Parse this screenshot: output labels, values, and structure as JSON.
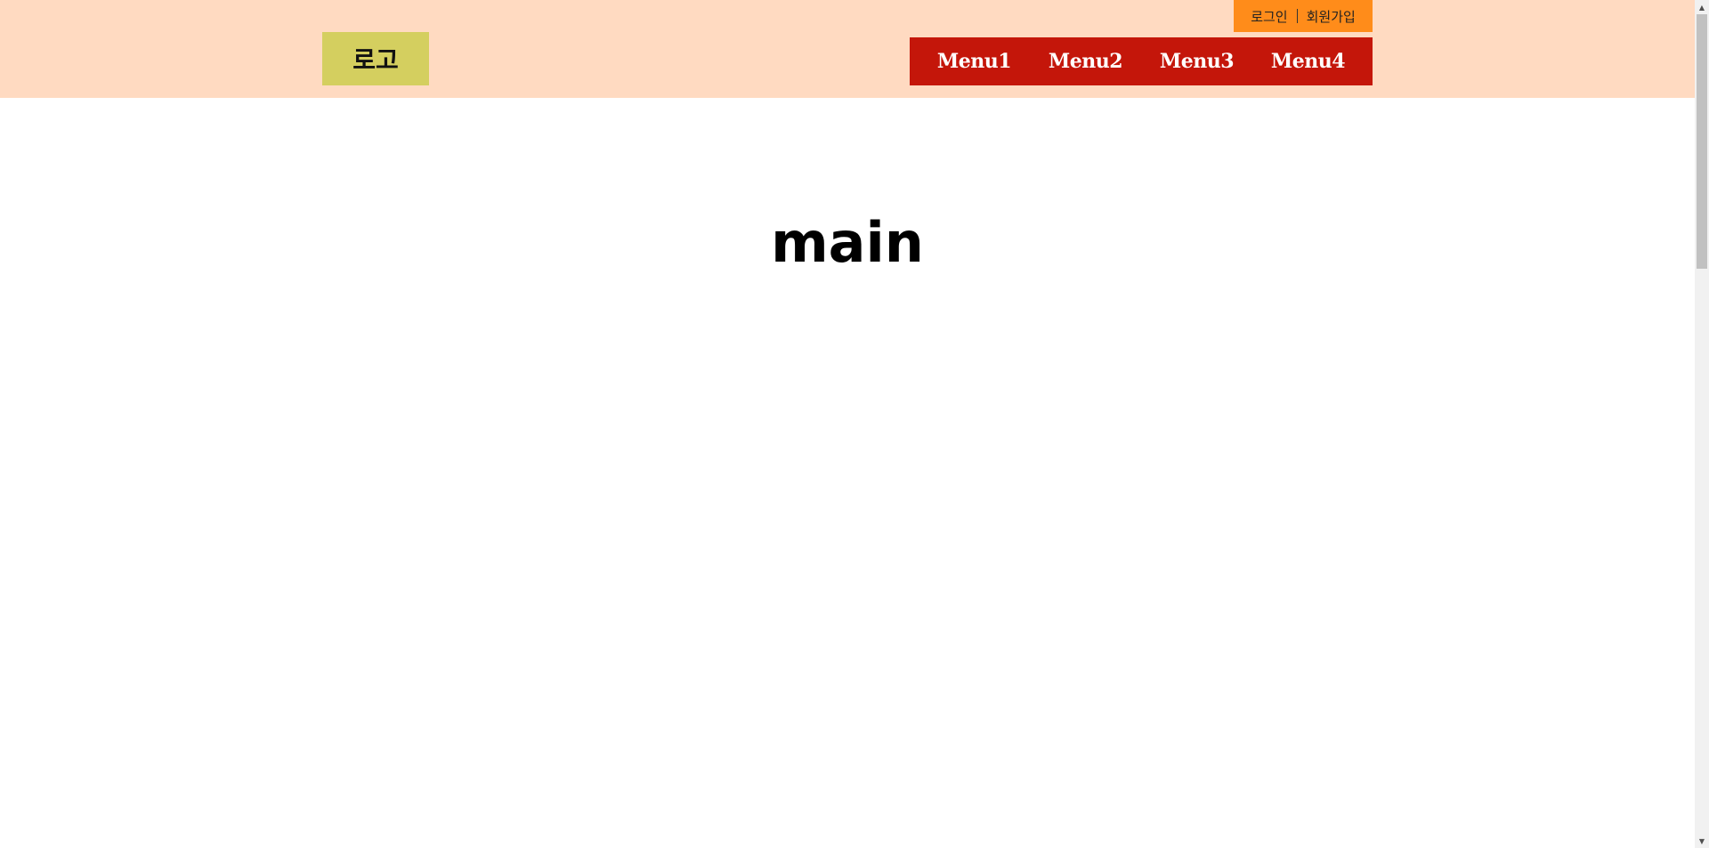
{
  "header": {
    "util_links": [
      "로그인",
      "회원가입"
    ],
    "logo_text": "로고",
    "menu": [
      "Menu1",
      "Menu2",
      "Menu3",
      "Menu4"
    ]
  },
  "main": {
    "title": "main"
  },
  "scrollbar": {
    "up_glyph": "▲",
    "down_glyph": "▼"
  },
  "colors": {
    "header_bg": "#ffdac1",
    "util_bg": "#ff8c1a",
    "logo_bg": "#d4cf5f",
    "menu_bg": "#c4160a"
  }
}
